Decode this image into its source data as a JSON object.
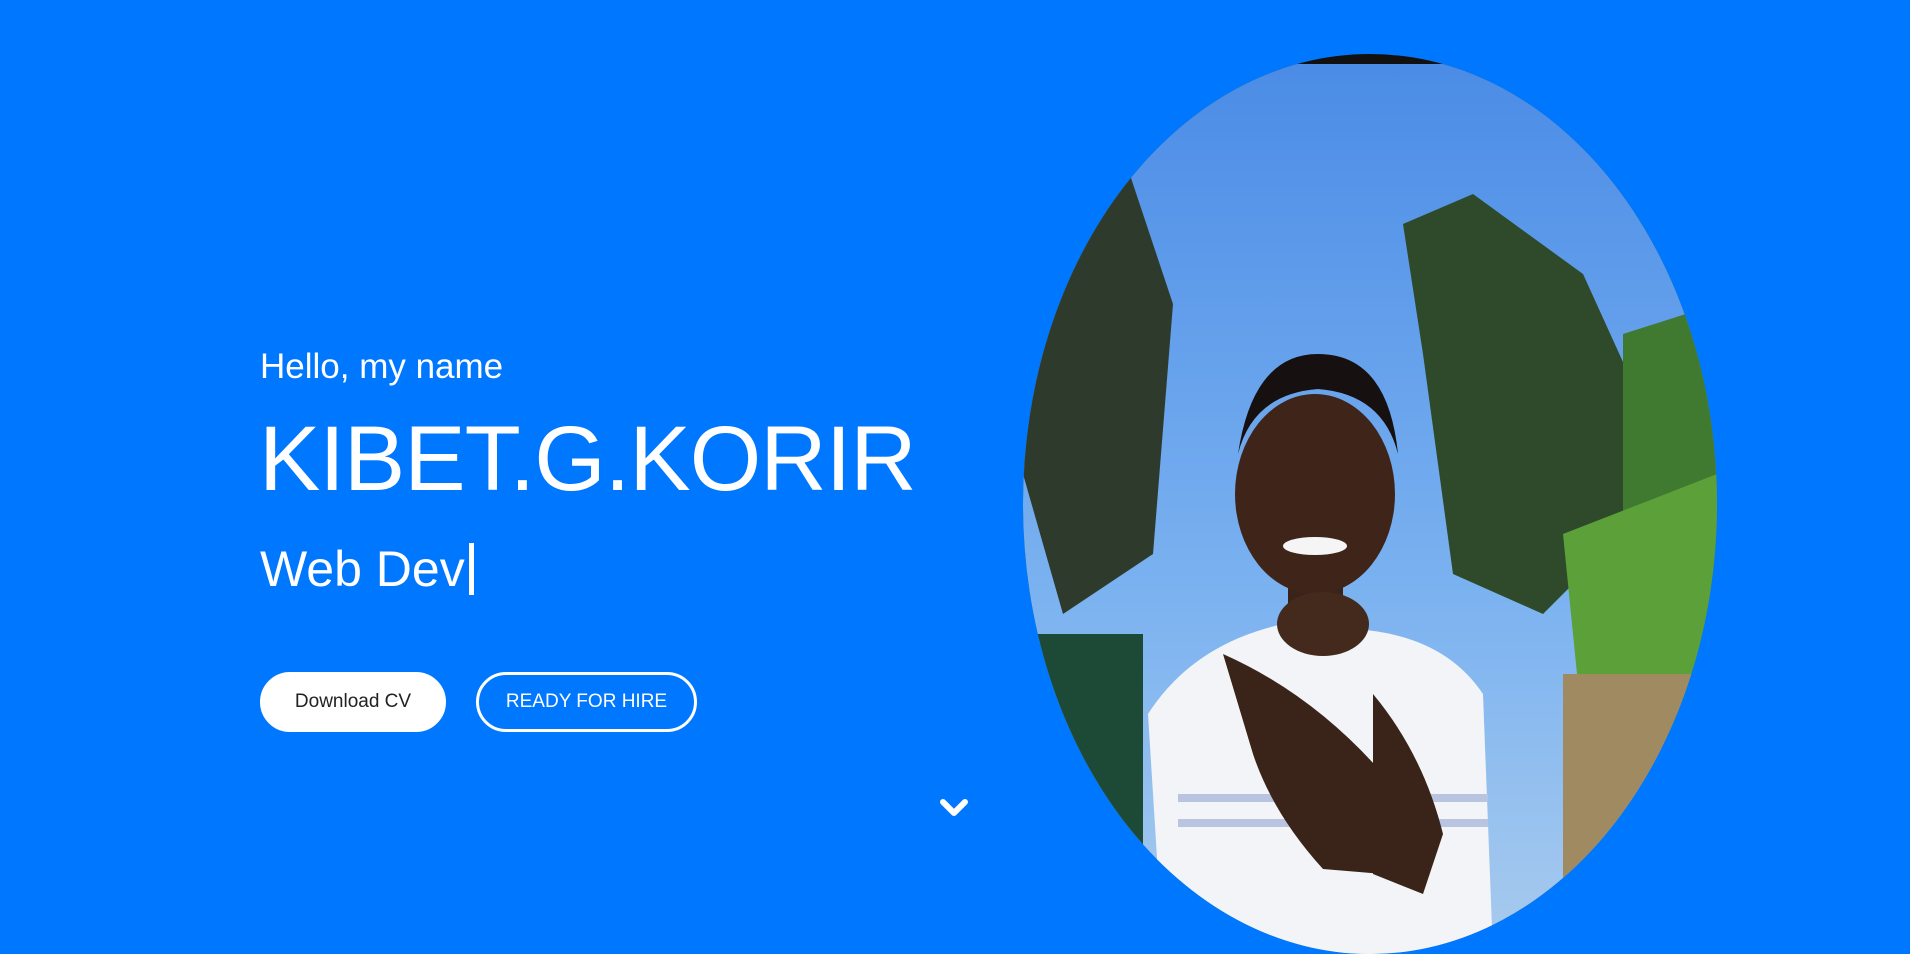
{
  "hero": {
    "greeting": "Hello, my name",
    "name": "KIBET.G.KORIR",
    "role": "Web Dev",
    "buttons": {
      "download_cv": "Download CV",
      "hire": "READY FOR HIRE"
    },
    "scroll_icon": "chevron-down-icon"
  },
  "colors": {
    "background": "#0077ff",
    "text": "#ffffff",
    "button_text_dark": "#222222"
  },
  "profile_photo": {
    "icon": "portrait-photo"
  }
}
